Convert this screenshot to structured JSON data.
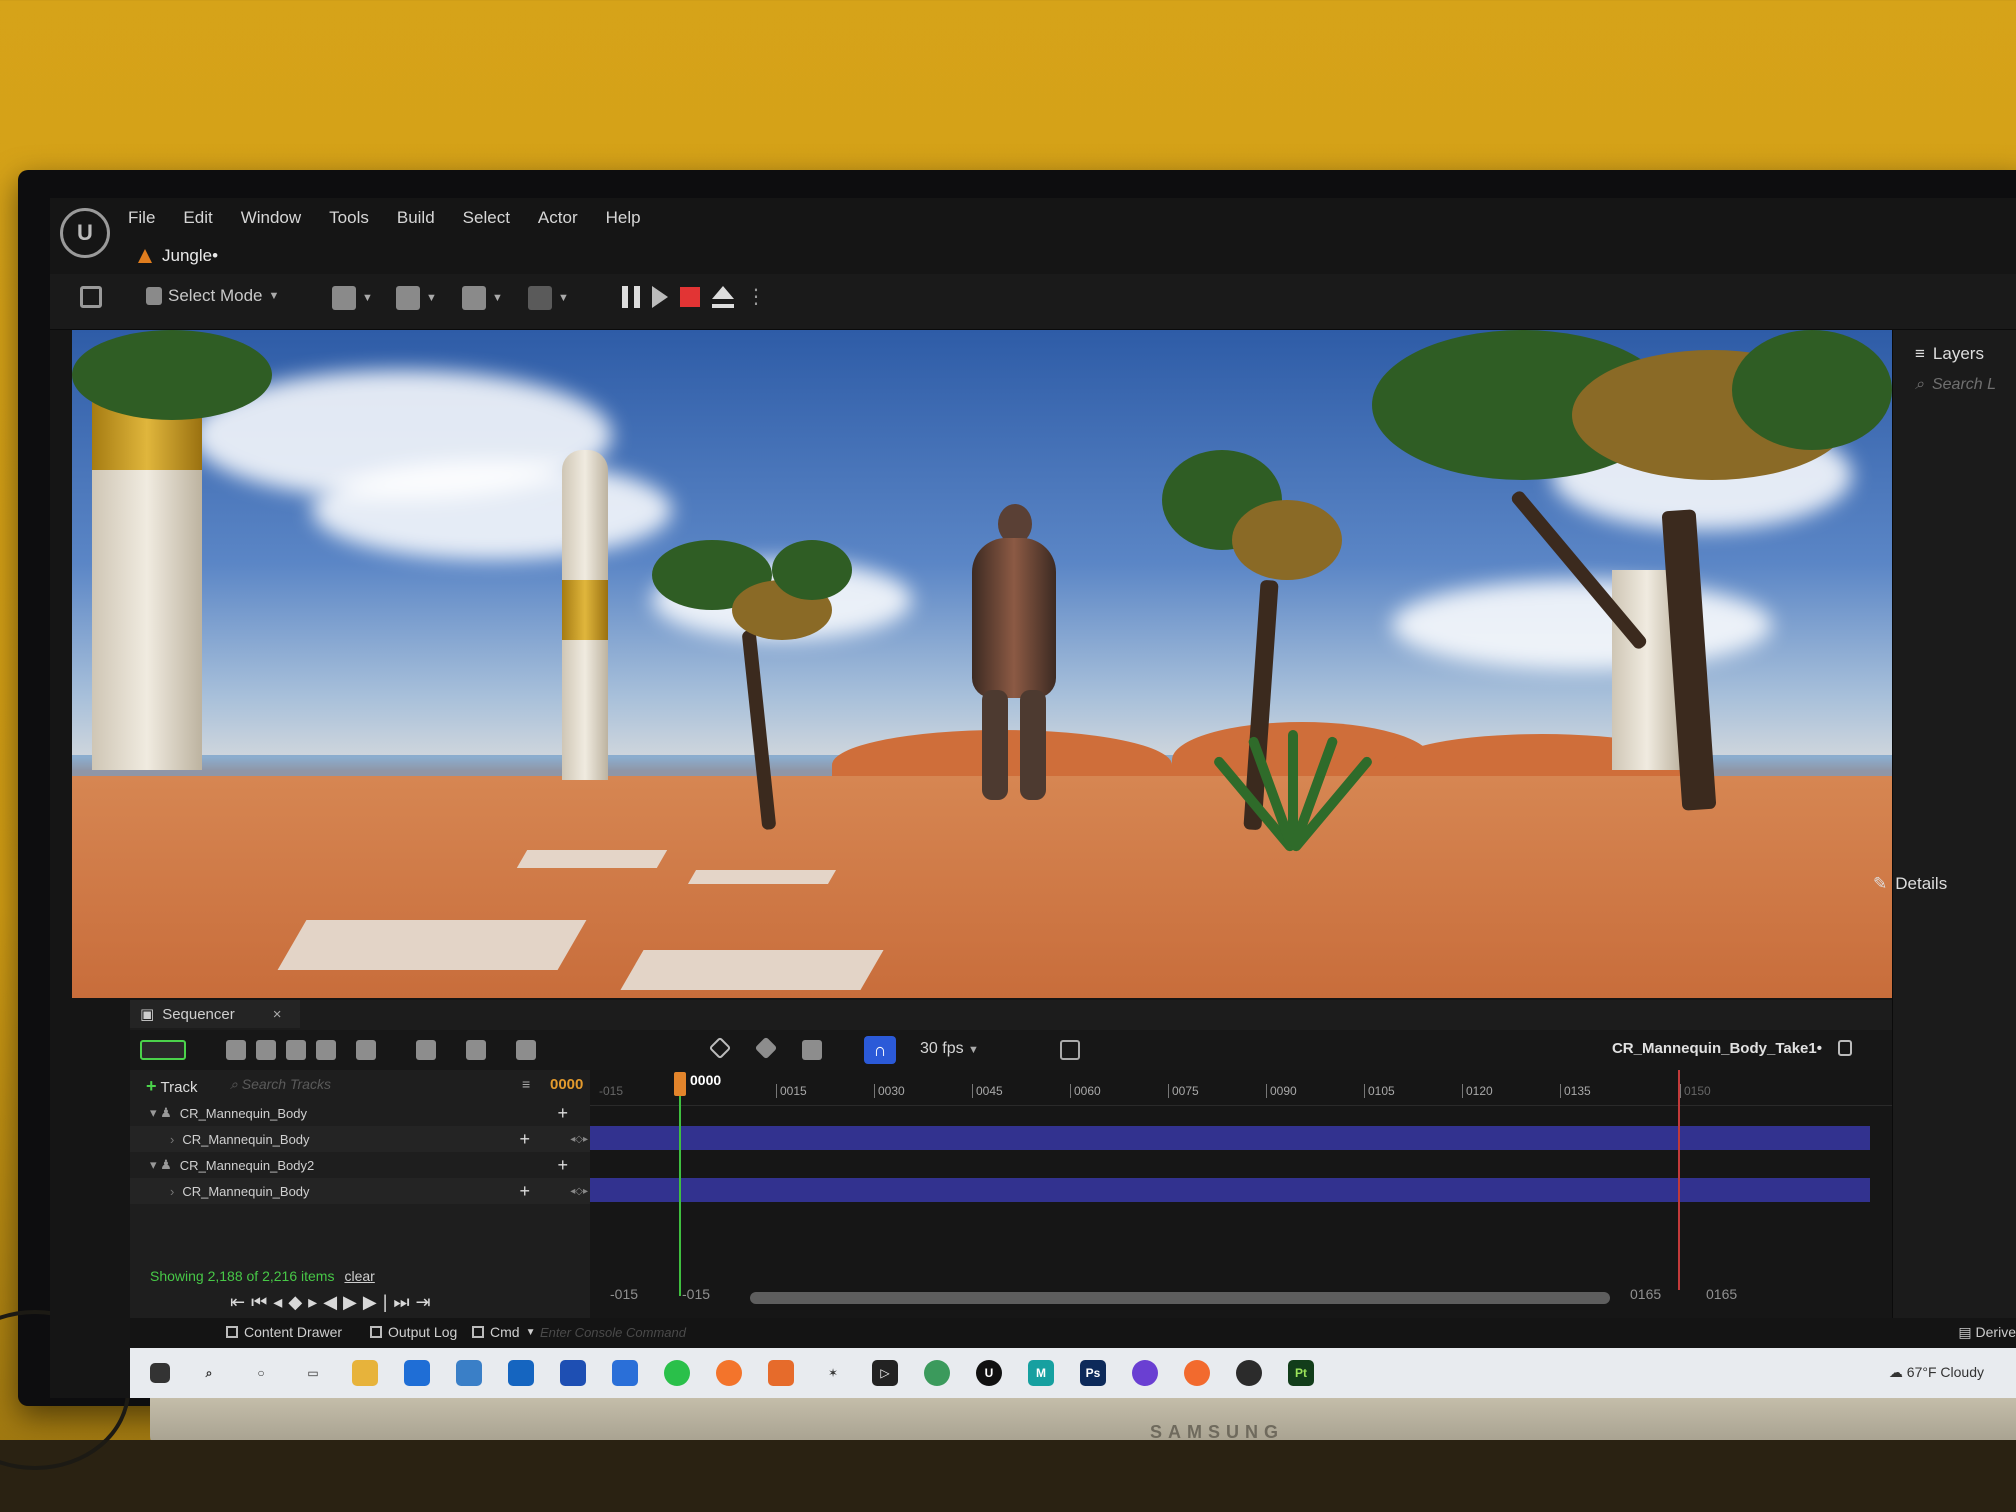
{
  "app": {
    "logo_text": "U",
    "menu": [
      "File",
      "Edit",
      "Window",
      "Tools",
      "Build",
      "Select",
      "Actor",
      "Help"
    ],
    "level_tab": "Jungle•"
  },
  "toolbar": {
    "select_mode": "Select Mode"
  },
  "right_panel": {
    "layers_title": "Layers",
    "search_placeholder": "Search L",
    "details_title": "Details"
  },
  "sequencer": {
    "tab_label": "Sequencer",
    "tab_close": "×",
    "fps": "30 fps",
    "sequence_name": "CR_Mannequin_Body_Take1•",
    "add_track_label": "Track",
    "search_placeholder": "Search Tracks",
    "current_frame": "0000",
    "tracks": [
      {
        "label": "CR_Mannequin_Body",
        "child": false
      },
      {
        "label": "CR_Mannequin_Body",
        "child": true
      },
      {
        "label": "CR_Mannequin_Body2",
        "child": false
      },
      {
        "label": "CR_Mannequin_Body",
        "child": true
      }
    ],
    "showing_text": "Showing 2,188 of 2,216 items",
    "clear_label": "clear",
    "ruler_start": "-015",
    "ruler_ticks": [
      "0015",
      "0030",
      "0045",
      "0060",
      "0075",
      "0090",
      "0105",
      "0120",
      "0135",
      "0150"
    ],
    "view_start": "-015",
    "play_start": "-015",
    "play_end": "0165",
    "view_end": "0165"
  },
  "bottom_bar": {
    "content_drawer": "Content Drawer",
    "output_log": "Output Log",
    "cmd": "Cmd",
    "console_placeholder": "Enter Console Command",
    "derive": "Derive"
  },
  "taskbar": {
    "weather": "67°F  Cloudy"
  },
  "monitor": {
    "brand": "SAMSUNG"
  }
}
